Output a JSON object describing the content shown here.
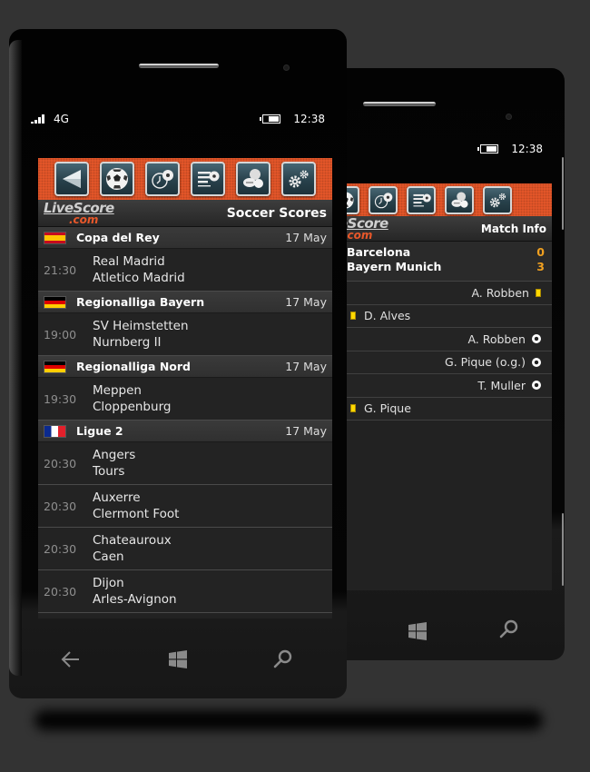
{
  "front_phone": {
    "status_bar": {
      "network": "4G",
      "time": "12:38",
      "signal_icon": "signal-bars-icon",
      "battery_icon": "battery-icon"
    },
    "toolbar": {
      "buttons": [
        {
          "name": "back",
          "icon": "back-arrow-icon"
        },
        {
          "name": "soccer",
          "icon": "soccer-ball-icon"
        },
        {
          "name": "fixtures-clock",
          "icon": "clock-ball-icon"
        },
        {
          "name": "standings",
          "icon": "table-ball-icon"
        },
        {
          "name": "all-sports",
          "icon": "sports-balls-icon"
        },
        {
          "name": "settings",
          "icon": "gears-icon"
        }
      ]
    },
    "logo": {
      "main": "LiveScore",
      "suffix": ".com"
    },
    "page_title": "Soccer Scores",
    "leagues": [
      {
        "name": "Copa del Rey",
        "date": "17 May",
        "flag": "spain",
        "matches": [
          {
            "time": "21:30",
            "home": "Real Madrid",
            "away": "Atletico Madrid"
          }
        ]
      },
      {
        "name": "Regionalliga Bayern",
        "date": "17 May",
        "flag": "germany",
        "matches": [
          {
            "time": "19:00",
            "home": "SV Heimstetten",
            "away": "Nurnberg II"
          }
        ]
      },
      {
        "name": "Regionalliga Nord",
        "date": "17 May",
        "flag": "germany",
        "matches": [
          {
            "time": "19:30",
            "home": "Meppen",
            "away": "Cloppenburg"
          }
        ]
      },
      {
        "name": "Ligue 2",
        "date": "17 May",
        "flag": "france",
        "matches": [
          {
            "time": "20:30",
            "home": "Angers",
            "away": "Tours"
          },
          {
            "time": "20:30",
            "home": "Auxerre",
            "away": "Clermont Foot"
          },
          {
            "time": "20:30",
            "home": "Chateauroux",
            "away": "Caen"
          },
          {
            "time": "20:30",
            "home": "Dijon",
            "away": "Arles-Avignon"
          }
        ]
      }
    ],
    "nav": {
      "back": "back-arrow-icon",
      "home": "windows-logo-icon",
      "search": "search-icon"
    }
  },
  "back_phone": {
    "status_bar": {
      "time": "12:38",
      "battery_icon": "battery-icon"
    },
    "page_title": "Match Info",
    "match": {
      "home": "Barcelona",
      "home_score": "0",
      "away": "Bayern Munich",
      "away_score": "3"
    },
    "events": [
      {
        "player": "A. Robben",
        "side": "away",
        "type": "yellow-card"
      },
      {
        "player": "D. Alves",
        "side": "home",
        "type": "yellow-card"
      },
      {
        "player": "A. Robben",
        "side": "away",
        "type": "goal"
      },
      {
        "player": "G. Pique (o.g.)",
        "side": "away",
        "type": "goal"
      },
      {
        "player": "T. Muller",
        "side": "away",
        "type": "goal"
      },
      {
        "player": "G. Pique",
        "side": "home",
        "type": "yellow-card"
      }
    ],
    "nav": {
      "home": "windows-logo-icon",
      "search": "search-icon"
    }
  },
  "colors": {
    "accent": "#e9582a",
    "score": "#f0a020",
    "yellow_card": "#ffd800",
    "background": "#333333"
  }
}
